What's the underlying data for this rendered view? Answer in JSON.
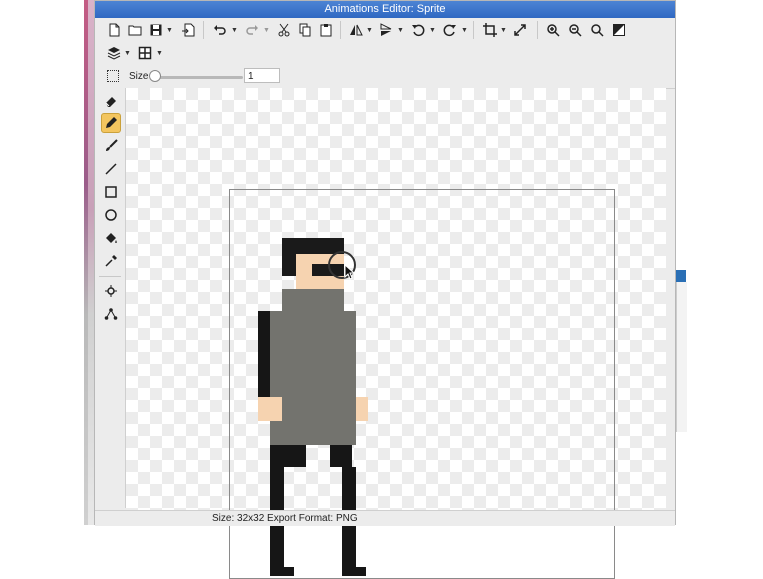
{
  "window": {
    "title": "Animations Editor: Sprite"
  },
  "toolbar": {
    "row1": [
      {
        "name": "new-file-icon",
        "label": "New"
      },
      {
        "name": "open-folder-icon",
        "label": "Open"
      },
      {
        "name": "save-icon",
        "label": "Save"
      },
      {
        "name": "export-icon",
        "label": "Export"
      },
      {
        "name": "undo-icon",
        "label": "Undo"
      },
      {
        "name": "redo-icon",
        "label": "Redo"
      },
      {
        "name": "cut-icon",
        "label": "Cut"
      },
      {
        "name": "copy-icon",
        "label": "Copy"
      },
      {
        "name": "paste-icon",
        "label": "Paste"
      },
      {
        "name": "flip-horizontal-icon",
        "label": "Flip Horizontal"
      },
      {
        "name": "flip-vertical-icon",
        "label": "Flip Vertical"
      },
      {
        "name": "rotate-left-icon",
        "label": "Rotate Left"
      },
      {
        "name": "rotate-right-icon",
        "label": "Rotate Right"
      },
      {
        "name": "crop-icon",
        "label": "Crop"
      },
      {
        "name": "resize-icon",
        "label": "Resize"
      },
      {
        "name": "zoom-in-icon",
        "label": "Zoom In"
      },
      {
        "name": "zoom-out-icon",
        "label": "Zoom Out"
      },
      {
        "name": "zoom-fit-icon",
        "label": "Zoom Fit"
      },
      {
        "name": "invert-icon",
        "label": "Invert"
      }
    ],
    "row2": [
      {
        "name": "layers-icon",
        "label": "Layers"
      },
      {
        "name": "grid-icon",
        "label": "Grid"
      }
    ]
  },
  "brush": {
    "size_label": "Size",
    "size_value": "1",
    "size_slider_level": 0
  },
  "tools": [
    {
      "name": "eraser-icon"
    },
    {
      "name": "pencil-icon",
      "active": true
    },
    {
      "name": "brush-icon"
    },
    {
      "name": "line-icon"
    },
    {
      "name": "rectangle-icon"
    },
    {
      "name": "ellipse-icon"
    },
    {
      "name": "fill-bucket-icon"
    },
    {
      "name": "eyedropper-icon"
    },
    {
      "name": "anchor-point-icon"
    },
    {
      "name": "bone-tool-icon"
    }
  ],
  "status": {
    "text": "Size: 32x32   Export Format: PNG"
  },
  "colors": {
    "accent_active_tool": "#f3c55f",
    "titlebar": "#3a74c9",
    "sprite_hair": "#1a1a1a",
    "sprite_skin": "#f6d3b0",
    "sprite_shirt": "#73736e",
    "sprite_pants": "#161616"
  }
}
